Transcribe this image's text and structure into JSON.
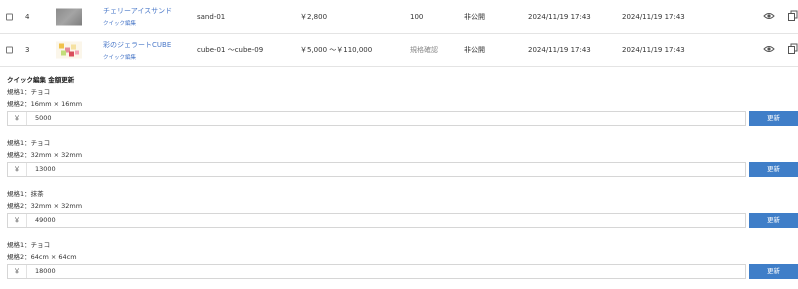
{
  "rows": [
    {
      "number": "4",
      "name": "チェリーアイスサンド",
      "quick_edit": "クイック編集",
      "sku": "sand-01",
      "price": "￥2,800",
      "stock": "100",
      "status": "非公開",
      "created": "2024/11/19 17:43",
      "updated": "2024/11/19 17:43"
    },
    {
      "number": "3",
      "name": "彩のジェラートCUBE",
      "quick_edit": "クイック編集",
      "sku": "cube-01 ～cube-09",
      "price": "￥5,000 ～￥110,000",
      "stock": "規格確認",
      "status": "非公開",
      "created": "2024/11/19 17:43",
      "updated": "2024/11/19 17:43"
    }
  ],
  "quick_edit_panel": {
    "title": "クイック編集 金額更新",
    "currency": "￥",
    "button_label": "更新",
    "variants": [
      {
        "spec1": "規格1：チョコ",
        "spec2": "規格2：16mm × 16mm",
        "price": "5000"
      },
      {
        "spec1": "規格1：チョコ",
        "spec2": "規格2：32mm × 32mm",
        "price": "13000"
      },
      {
        "spec1": "規格1：抹茶",
        "spec2": "規格2：32mm × 32mm",
        "price": "49000"
      },
      {
        "spec1": "規格1：チョコ",
        "spec2": "規格2：64cm × 64cm",
        "price": "18000"
      }
    ]
  },
  "colors": {
    "link": "#4a78c8",
    "button": "#3f7ec8"
  },
  "icons": [
    "checkbox",
    "eye-icon",
    "copy-icon"
  ]
}
